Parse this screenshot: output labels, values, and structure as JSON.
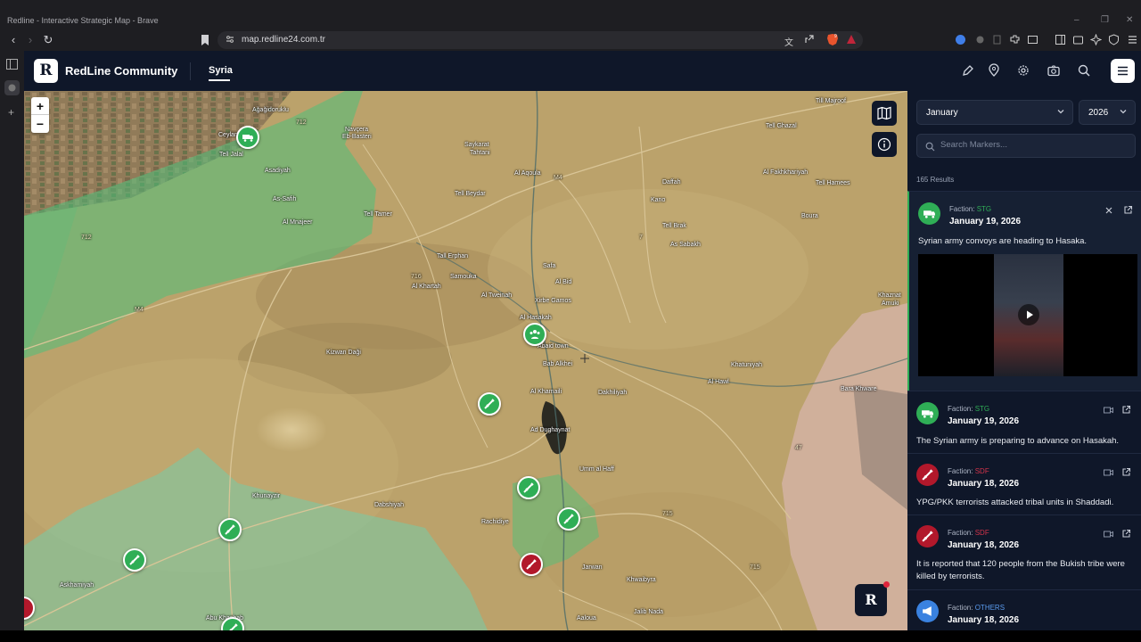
{
  "browser": {
    "window_title": "Redline - Interactive Strategic Map - Brave",
    "url": "map.redline24.com.tr"
  },
  "app": {
    "logo_letter": "R",
    "name": "RedLine Community",
    "tabs": [
      {
        "label": "Syria",
        "active": true
      }
    ],
    "header_icons": [
      "pen-icon",
      "location-pin-icon",
      "settings-icon",
      "camera-icon",
      "search-icon",
      "menu-icon"
    ]
  },
  "map": {
    "zoom_in": "+",
    "zoom_out": "−",
    "float_letter": "R",
    "labels": {
      "agagidorukly": "Ağağidoruklu",
      "ceylan": "Ceylan",
      "tell_jalal": "Tell Jalal",
      "asadiyah": "Asadiyah",
      "as_safih": "As-Safih",
      "al_mnajeer": "Al Mnajeer",
      "navcera": "Navçera",
      "eb_basteri": "Eb-Basteri",
      "saykarat": "Saykarat",
      "tahtani": "Tahtani",
      "al_aqoula": "Al Aqoula",
      "tell_beydar": "Tell Beydar",
      "tell_tamer": "Tell Tamer",
      "tall_erphan": "Tall Erphan",
      "samouka": "Samouka",
      "al_khartah": "Al Khartah",
      "al_tweinah": "Al Tweinah",
      "safa": "Safa",
      "al_bid": "Al Bid",
      "xirbe_gamos": "Xirbe Gamos",
      "al_hasakah": "Al Hasakah",
      "abaid_town": "Abaid town",
      "bab_alkhei": "Bab Alkhei",
      "al_khamaili": "Al Khamaili",
      "ad_dughaynat": "Ad Dughaynat",
      "dakhiliyah": "Dakhiliyah",
      "kizwan_dagi": "Kizwan Daği",
      "umm_al_haff": "Umm al Haff",
      "dabshiyah": "Dabshiyah",
      "khunayzir": "Khunayzir",
      "rachidiye": "Rachidiye",
      "jarwan": "Jarwan",
      "khwaibyra": "Khwaibyra",
      "jalib_nada": "Jalib Nada",
      "askhamiyah": "Askhamiyah",
      "abu_khashab": "Abu Khashab",
      "aaloua": "Aaloua",
      "daffah": "Daffah",
      "kano": "Kano",
      "tell_brak": "Tell Brak",
      "as_sabakh": "As Sabakh",
      "boura": "Boura",
      "tell_ghazal": "Tell Ghazal",
      "al_fakhkhariyah": "Al Fakhkhariyah",
      "tell_hamees": "Tell Hamees",
      "tell_majroof": "Till Majroof",
      "khatuniyah": "Khatuniyah",
      "al_hawl": "Al Hawl",
      "khaznat": "Khaznat",
      "amuki": "Amuki",
      "bara_khware": "Bara Khware",
      "road_m4_w": "M4",
      "road_m4_c": "M4",
      "road_712": "712",
      "road_712b": "712",
      "road_716": "716",
      "road_7": "7",
      "road_715": "715",
      "road_47": "47",
      "road_715b": "715"
    }
  },
  "panel": {
    "month": "January",
    "year": "2026",
    "search_placeholder": "Search Markers...",
    "results": "165 Results",
    "events": [
      {
        "faction_label": "Faction:",
        "faction": "STG",
        "faction_color": "#2fae56",
        "date": "January 19, 2026",
        "text": "Syrian army convoys are heading to Hasaka.",
        "icon": "truck-icon",
        "has_video": true
      },
      {
        "faction_label": "Faction:",
        "faction": "STG",
        "faction_color": "#2fae56",
        "date": "January 19, 2026",
        "text": "The Syrian army is preparing to advance on Hasakah.",
        "icon": "truck-icon"
      },
      {
        "faction_label": "Faction:",
        "faction": "SDF",
        "faction_color": "#d2334a",
        "date": "January 18, 2026",
        "text": "YPG/PKK terrorists attacked tribal units in Shaddadi.",
        "icon": "rifle-icon"
      },
      {
        "faction_label": "Faction:",
        "faction": "SDF",
        "faction_color": "#d2334a",
        "date": "January 18, 2026",
        "text": "It is reported that 120 people from the Bukish tribe were killed by terrorists.",
        "icon": "rifle-icon"
      },
      {
        "faction_label": "Faction:",
        "faction": "OTHERS",
        "faction_color": "#5b9cf0",
        "date": "January 18, 2026",
        "text": "",
        "icon": "megaphone-icon"
      }
    ]
  },
  "colors": {
    "app_bg": "#0f1729",
    "stg_green": "#2fae56",
    "sdf_red": "#b2182b"
  }
}
